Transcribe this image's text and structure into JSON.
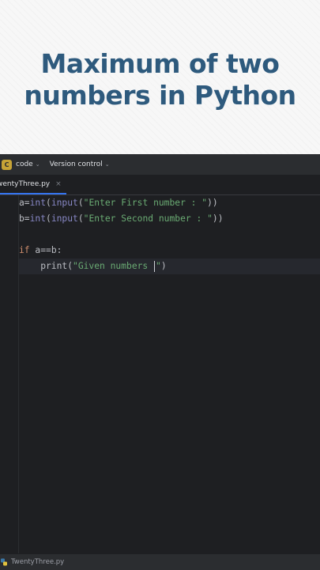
{
  "banner": {
    "line1": "Maximum of two",
    "line2": "numbers in Python"
  },
  "toolbar": {
    "project_badge": "C",
    "project_name": "code",
    "vcs_label": "Version control"
  },
  "tab": {
    "label": "wentyThree.py",
    "close": "×"
  },
  "code": {
    "line1": {
      "a": "a=",
      "b": "int",
      "c": "(",
      "d": "input",
      "e": "(",
      "f": "\"Enter First number : \"",
      "g": "))"
    },
    "line2": {
      "a": "b=",
      "b": "int",
      "c": "(",
      "d": "input",
      "e": "(",
      "f": "\"Enter Second number : \"",
      "g": "))"
    },
    "line4": {
      "a": "if",
      "b": " a==b:"
    },
    "line5": {
      "a": "    print(",
      "b": "\"Given numbers ",
      "c": "\"",
      "d": ")"
    }
  },
  "status": {
    "file": "TwentyThree.py"
  },
  "colors": {
    "title": "#2e5a7d",
    "keyword": "#cf8e6d",
    "builtin": "#8888c6",
    "string": "#6aab73",
    "editor_bg": "#1e1f22"
  }
}
